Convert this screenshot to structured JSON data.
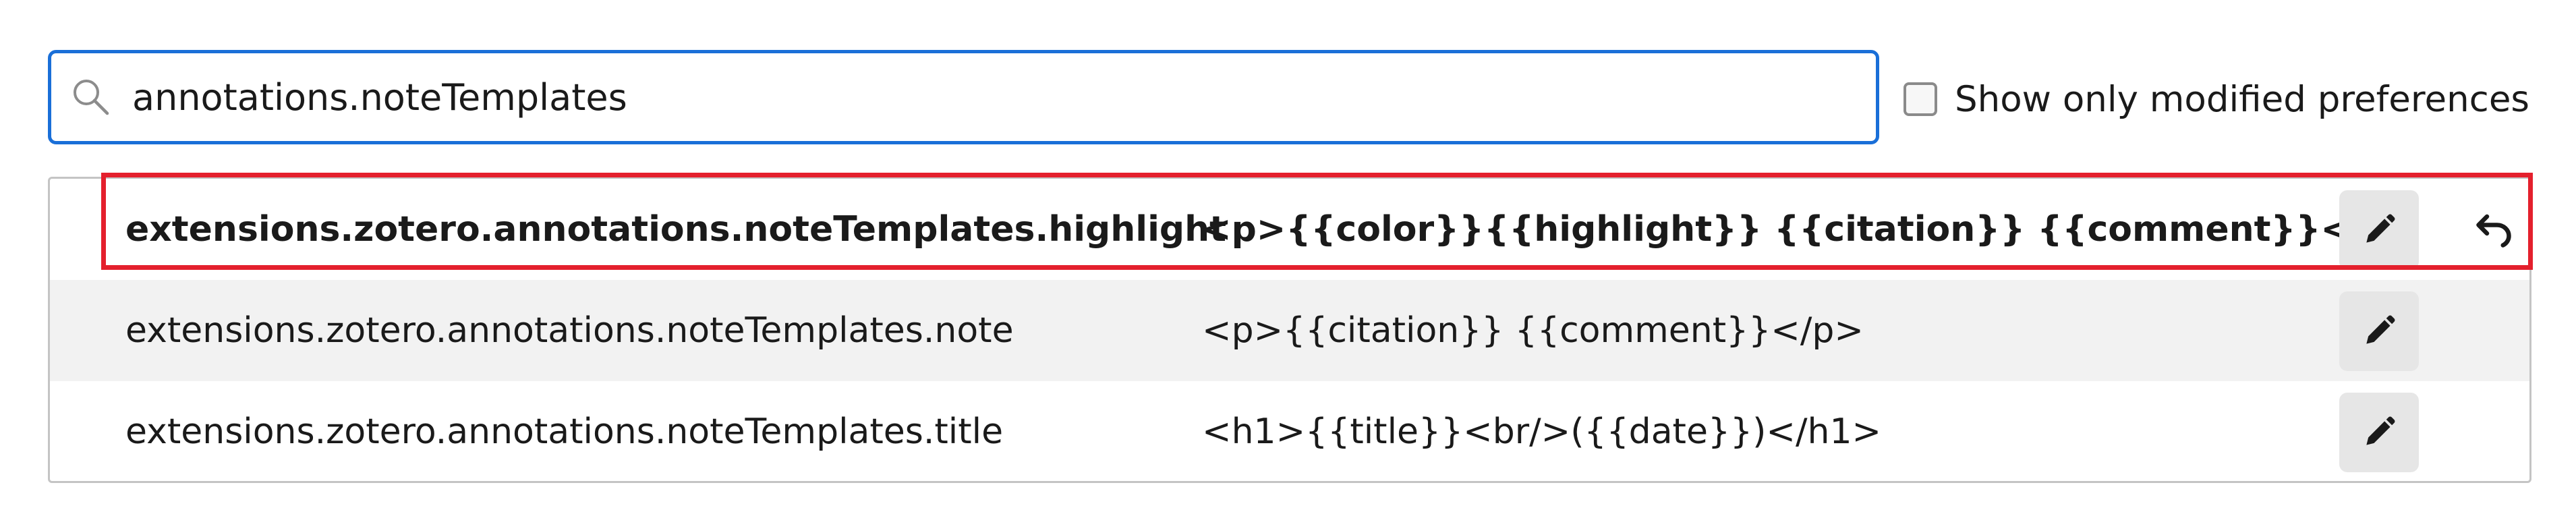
{
  "search": {
    "value": "annotations.noteTemplates",
    "icon": "search-icon"
  },
  "filter": {
    "label": "Show only modified preferences",
    "checked": false
  },
  "rows": [
    {
      "name": "extensions.zotero.annotations.noteTemplates.highlight",
      "value": "<p>{{color}}{{highlight}} {{citation}} {{comment}}</p>",
      "modified": true
    },
    {
      "name": "extensions.zotero.annotations.noteTemplates.note",
      "value": "<p>{{citation}} {{comment}}</p>",
      "modified": false
    },
    {
      "name": "extensions.zotero.annotations.noteTemplates.title",
      "value": "<h1>{{title}}<br/>({{date}})</h1>",
      "modified": false
    }
  ],
  "colors": {
    "focus": "#1a6fd8",
    "highlight_outline": "#e4202d",
    "row_alt": "#f2f2f2"
  }
}
